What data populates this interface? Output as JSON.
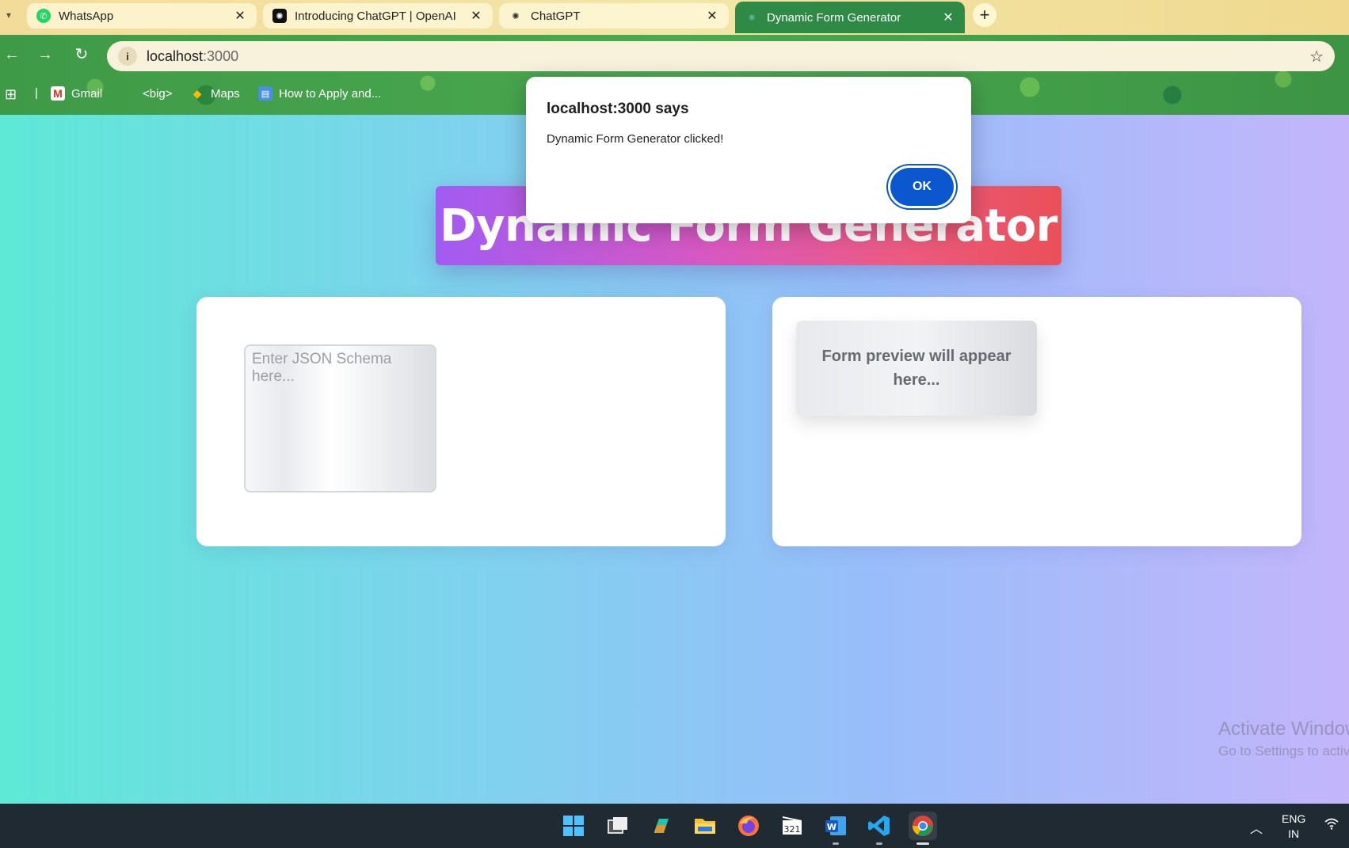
{
  "browser": {
    "tabs": [
      {
        "title": "WhatsApp",
        "icon": "whatsapp-icon",
        "active": false
      },
      {
        "title": "Introducing ChatGPT | OpenAI",
        "icon": "openai-icon",
        "active": false
      },
      {
        "title": "ChatGPT",
        "icon": "openai-icon",
        "active": false
      },
      {
        "title": "Dynamic Form Generator",
        "icon": "react-icon",
        "active": true
      }
    ],
    "url_host": "localhost",
    "url_port": ":3000",
    "bookmarks": [
      {
        "label": "Gmail",
        "icon": "gmail-icon"
      },
      {
        "label": "<big>",
        "icon": "bookmark-icon"
      },
      {
        "label": "Maps",
        "icon": "maps-icon"
      },
      {
        "label": "How to Apply and...",
        "icon": "page-icon"
      }
    ]
  },
  "page": {
    "hero_title": "Dynamic Form Generator",
    "schema_placeholder": "Enter JSON Schema here...",
    "preview_placeholder": "Form preview will appear here...",
    "watermark_line1": "Activate Windows",
    "watermark_line2": "Go to Settings to activate Windows."
  },
  "dialog": {
    "title": "localhost:3000 says",
    "message": "Dynamic Form Generator clicked!",
    "ok_label": "OK"
  },
  "taskbar": {
    "lang_top": "ENG",
    "lang_bottom": "IN",
    "apps": [
      "start",
      "task-view",
      "copilot",
      "file-explorer",
      "firefox",
      "clipchamp",
      "word",
      "vscode",
      "chrome"
    ]
  },
  "colors": {
    "accent_blue": "#0b57d0",
    "hero_gradient_start": "#a25bf2",
    "hero_gradient_end": "#ea5058",
    "page_gradient_start": "#5ee8d6",
    "page_gradient_end": "#c4b5fb"
  }
}
